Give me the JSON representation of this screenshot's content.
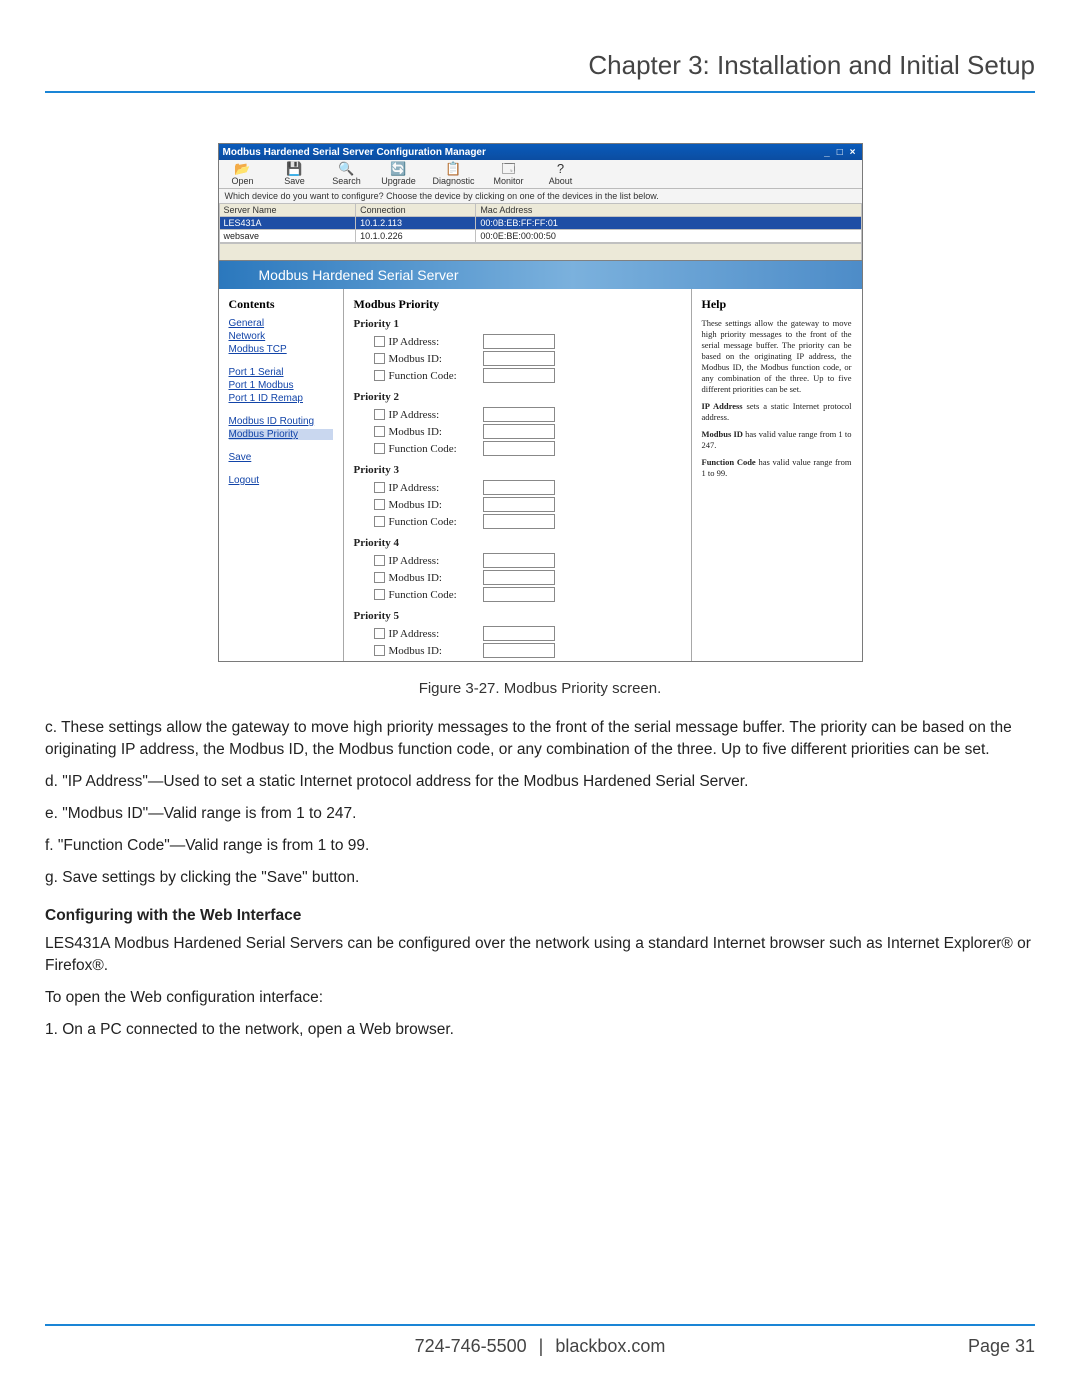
{
  "chapter_title": "Chapter 3: Installation and Initial Setup",
  "window": {
    "title": "Modbus Hardened Serial Server Configuration Manager",
    "win_min": "_",
    "win_max": "□",
    "win_close": "×",
    "toolbar": [
      {
        "icon": "📂",
        "label": "Open"
      },
      {
        "icon": "💾",
        "label": "Save"
      },
      {
        "icon": "🔍",
        "label": "Search"
      },
      {
        "icon": "🔄",
        "label": "Upgrade"
      },
      {
        "icon": "📋",
        "label": "Diagnostic"
      },
      {
        "icon": "🗔",
        "label": "Monitor"
      },
      {
        "icon": "?",
        "label": "About"
      }
    ],
    "instruction": "Which device do you want to configure? Choose the device by clicking on one of the devices in the list below.",
    "columns": [
      "Server Name",
      "Connection",
      "Mac Address"
    ],
    "rows": [
      {
        "name": "LES431A",
        "conn": "10.1.2.113",
        "mac": "00:0B:EB:FF:FF:01",
        "selected": true
      },
      {
        "name": "websave",
        "conn": "10.1.0.226",
        "mac": "00:0E:BE:00:00:50",
        "selected": false
      }
    ]
  },
  "embedded": {
    "banner": "Modbus Hardened Serial Server",
    "contents_heading": "Contents",
    "menu": [
      {
        "label": "General"
      },
      {
        "label": "Network"
      },
      {
        "label": "Modbus TCP"
      },
      {
        "spacer": true
      },
      {
        "label": "Port 1 Serial"
      },
      {
        "label": "Port 1 Modbus"
      },
      {
        "label": "Port 1 ID Remap"
      },
      {
        "spacer": true
      },
      {
        "label": "Modbus ID Routing"
      },
      {
        "label": "Modbus Priority",
        "selected": true
      },
      {
        "spacer": true
      },
      {
        "label": "Save"
      },
      {
        "spacer": true
      },
      {
        "label": "Logout"
      }
    ],
    "main_heading": "Modbus Priority",
    "fields": [
      "IP Address:",
      "Modbus ID:",
      "Function Code:"
    ],
    "priorities": [
      "Priority 1",
      "Priority 2",
      "Priority 3",
      "Priority 4",
      "Priority 5"
    ],
    "help_heading": "Help",
    "help_paras": [
      "These settings allow the gateway to move high priority messages to the front of the serial message buffer. The priority can be based on the originating IP address, the Modbus ID, the Modbus function code, or any combination of the three. Up to five different priorities can be set.",
      "IP Address sets a static Internet protocol address.",
      "Modbus ID has valid value range from 1 to 247.",
      "Function Code has valid value range from 1 to 99."
    ],
    "help_bolds": [
      "IP Address",
      "Modbus ID",
      "Function Code"
    ]
  },
  "caption": "Figure 3-27. Modbus Priority screen.",
  "body": {
    "c": "c. These settings allow the gateway to move high priority messages to the front of the serial message buffer. The priority can be based on the originating IP address, the Modbus ID, the Modbus function code, or any combination of the three. Up to five different priorities can be set.",
    "d": "d. \"IP Address\"—Used to set a static Internet protocol address for the Modbus Hardened Serial Server.",
    "e": "e. \"Modbus ID\"—Valid range is from 1 to 247.",
    "f": "f. \"Function Code\"—Valid range is from 1 to 99.",
    "g": "g. Save settings by clicking the \"Save\" button.",
    "subhead": "Configuring with the Web Interface",
    "p1": "LES431A Modbus Hardened Serial Servers can be configured over the network using a standard Internet browser such as Internet Explorer® or Firefox®.",
    "p2": "To open the Web configuration interface:",
    "p3": "1. On a PC connected to the network, open a Web browser."
  },
  "footer": {
    "phone": "724-746-5500",
    "site": "blackbox.com",
    "page": "Page 31"
  }
}
